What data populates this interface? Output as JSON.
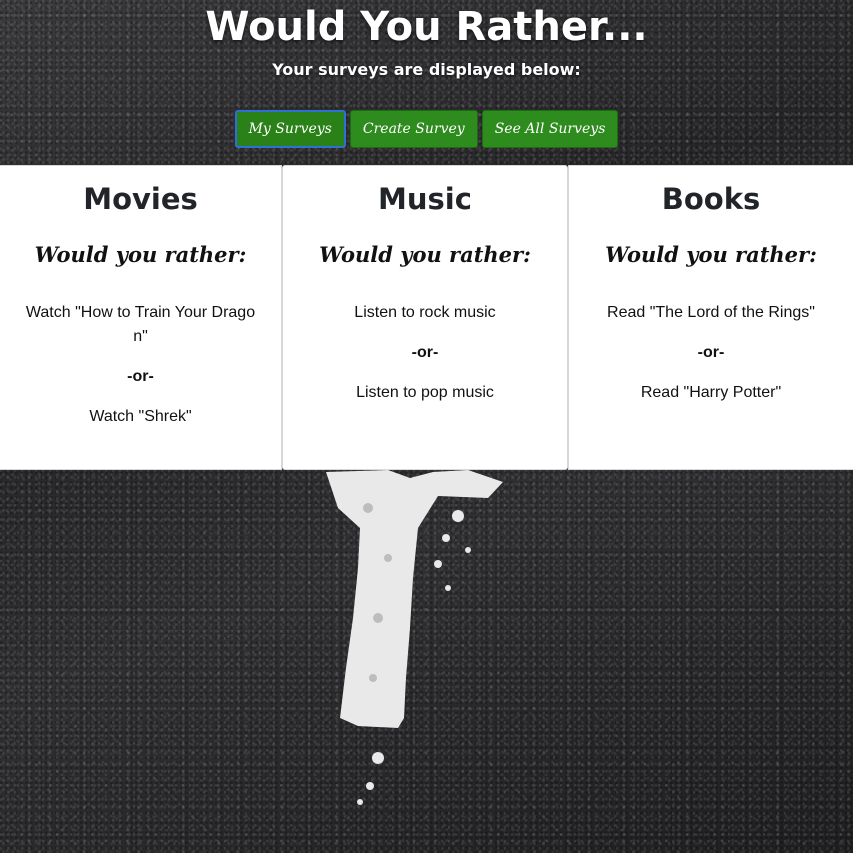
{
  "header": {
    "title": "Would You Rather...",
    "subtitle": "Your surveys are displayed below:"
  },
  "nav": {
    "items": [
      {
        "label": "My Surveys",
        "active": true
      },
      {
        "label": "Create Survey",
        "active": false
      },
      {
        "label": "See All Surveys",
        "active": false
      }
    ]
  },
  "surveys": [
    {
      "title": "Movies",
      "question": "Would you rather:",
      "option_a": "Watch \"How to Train Your Dragon\"",
      "separator": "-or-",
      "option_b": "Watch \"Shrek\""
    },
    {
      "title": "Music",
      "question": "Would you rather:",
      "option_a": "Listen to rock music",
      "separator": "-or-",
      "option_b": "Listen to pop music"
    },
    {
      "title": "Books",
      "question": "Would you rather:",
      "option_a": "Read \"The Lord of the Rings\"",
      "separator": "-or-",
      "option_b": "Read \"Harry Potter\""
    }
  ],
  "colors": {
    "button_bg": "#2e8b1e",
    "active_border": "#2f6fd6",
    "card_bg": "#ffffff"
  }
}
